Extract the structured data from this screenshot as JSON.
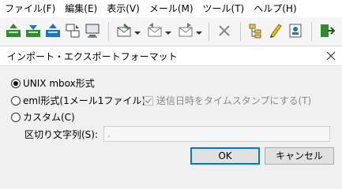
{
  "menu": [
    "ファイル(F)",
    "編集(E)",
    "表示(V)",
    "メール(M)",
    "ツール(T)",
    "ヘルプ(H)"
  ],
  "toolbar": {
    "icons": [
      "send-receive-icon",
      "receive-icon",
      "send-icon",
      "sync-icon",
      "computer-icon",
      "new-mail-icon",
      "reply-icon",
      "forward-icon",
      "delete-icon",
      "folder-tree-icon",
      "edit-pencil-icon",
      "address-book-icon",
      "exit-icon"
    ]
  },
  "dialog": {
    "title": "インポート・エクスポートフォーマット",
    "options": [
      {
        "label": "UNIX mbox形式",
        "checked": true
      },
      {
        "label": "eml形式(1メール1ファイル)",
        "checked": false
      },
      {
        "label": "カスタム(C)",
        "checked": false
      }
    ],
    "checkbox_label": "送信日時をタイムスタンプにする(T)",
    "separator_label": "区切り文字列(S):",
    "separator_value": ".",
    "ok_label": "OK",
    "cancel_label": "キャンセル"
  },
  "colors": {
    "accent": "#0078d7",
    "icon_green": "#2e8b2e",
    "icon_blue": "#1e73be"
  }
}
